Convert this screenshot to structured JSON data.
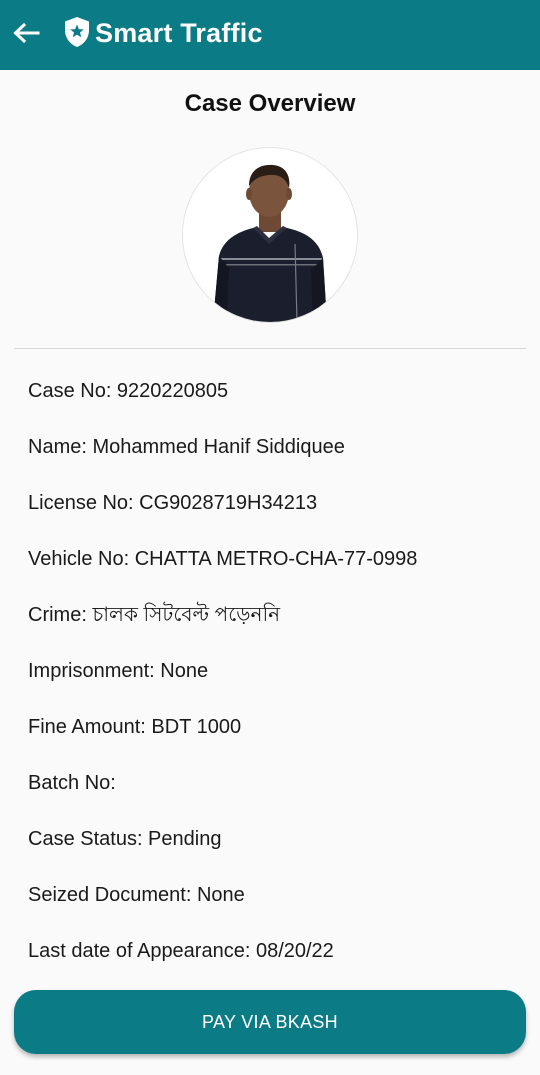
{
  "app": {
    "title": "Smart Traffic",
    "accent_color": "#0b7b86",
    "back_icon": "arrow-left-icon",
    "logo_icon": "shield-star-icon"
  },
  "page": {
    "title": "Case Overview"
  },
  "case": {
    "case_no": "Case No: 9220220805",
    "name": "Name: Mohammed Hanif Siddiquee",
    "license_no": "License No: CG9028719H34213",
    "vehicle_no": "Vehicle No: CHATTA METRO-CHA-77-0998",
    "crime": "Crime: চালক সিটবেল্ট পড়েননি",
    "imprisonment": "Imprisonment: None",
    "fine_amount": "Fine Amount: BDT 1000",
    "batch_no": "Batch No:",
    "case_status": "Case Status: Pending",
    "seized_document": "Seized Document: None",
    "last_date": "Last date of Appearance: 08/20/22"
  },
  "actions": {
    "pay_label": "PAY VIA BKASH"
  }
}
